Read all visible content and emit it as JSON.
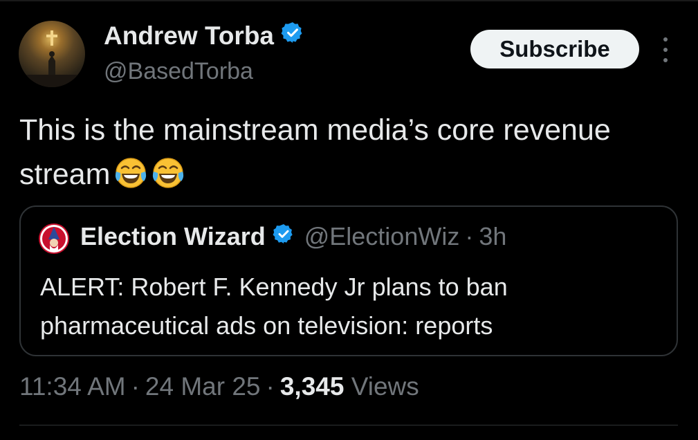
{
  "tweet": {
    "author": {
      "name": "Andrew Torba",
      "handle": "@BasedTorba"
    },
    "subscribe_label": "Subscribe",
    "text": "This is the mainstream media’s core revenue stream",
    "emojis": [
      "face-with-tears-of-joy",
      "face-with-tears-of-joy"
    ],
    "quote": {
      "name": "Election Wizard",
      "handle": "@ElectionWiz",
      "separator": "·",
      "time": "3h",
      "text": "ALERT: Robert F. Kennedy Jr plans to ban pharmaceutical ads on television: reports"
    },
    "meta": {
      "time": "11:34 AM",
      "date": "24 Mar 25",
      "separator": "·",
      "views_count": "3,345",
      "views_label": "Views"
    }
  },
  "colors": {
    "background": "#000000",
    "text_primary": "#e7e9ea",
    "text_secondary": "#71767b",
    "verified": "#1d9bf0",
    "border": "#2f3336"
  },
  "icons": [
    "verified-badge-icon",
    "more-options-icon",
    "face-with-tears-of-joy-icon"
  ]
}
